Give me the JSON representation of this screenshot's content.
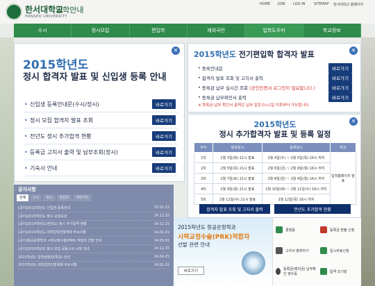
{
  "header": {
    "univ_name": "한서대학교",
    "univ_sub": "입학안내",
    "univ_eng": "HANSEO UNIVERSITY",
    "util_links": [
      "HOME",
      "JOIN",
      "LOG-IN",
      "SITEMAP",
      "한서대학교 홈페이지"
    ]
  },
  "gnb": [
    "수시",
    "정시모집",
    "편입학",
    "재외국민",
    "입학도우미",
    "학교정보"
  ],
  "popup1": {
    "year": "2015학년도",
    "title": "정시 합격자 발표 및 신입생 등록 안내",
    "items": [
      {
        "label": "신입생 등록안내문(수시/정시)",
        "button": "바로가기"
      },
      {
        "label": "정시 모집 합격자 발표 조회",
        "button": "바로가기"
      },
      {
        "label": "전년도 정시 추가합격 현황",
        "button": "바로가기"
      },
      {
        "label": "등록금 고지서 출력 및 납부조회(정시)",
        "button": "바로가기"
      },
      {
        "label": "기숙사 안내",
        "button": "바로가기"
      }
    ]
  },
  "popup2": {
    "year": "2015학년도",
    "title": "전기편입학 합격자 발표",
    "items": [
      {
        "label": "등록안내문",
        "note": "",
        "button": "바로가기"
      },
      {
        "label": "합격자 발표 조회 및 고지서 출력",
        "note": "",
        "button": "바로가기"
      },
      {
        "label": "등록금 납부 실시간 조회",
        "note": "(공인인증서 로그인이 필요합니다.)",
        "button": "바로가기"
      },
      {
        "label": "등록금 납부확인서 출력",
        "note": "",
        "button": "바로가기"
      }
    ],
    "footnote": "※ 등록금 납부 확인서 출력은 납부 일정 D+2일 이후부터 가능합니다."
  },
  "popup3": {
    "year": "2015학년도",
    "title": "정시 추가합격자 발표 및 등록 일정",
    "columns": [
      "차수",
      "발표일시",
      "등록일시",
      "비고"
    ],
    "rows": [
      [
        "1차",
        "2월 3일(화) 21시 발표",
        "2월 4일(수) ~ 2월 5일(목) 16시 까지"
      ],
      [
        "2차",
        "2월 5일(목) 21시 발표",
        "2월 6일(금) ~ 2월 9일(월) 16시 까지"
      ],
      [
        "3차",
        "2월 7일(토) 21시 발표",
        "2월 8일(일) ~ 2월 9일(월) 16시 까지"
      ],
      [
        "4차",
        "2월 9일(월) 21시 발표",
        "2월 10일(화) ~ 2월 11일(수) 16시 까지"
      ],
      [
        "5차",
        "2월 11일(수) 21시 발표",
        "2월 12일(목) 16시 까지"
      ]
    ],
    "remark": "입학홈페이지 발표",
    "btn_left": "합격자 발표 조회 및 고지서 출력",
    "btn_right": "전년도 추가합격 현황"
  },
  "notice": {
    "title": "공지사항",
    "tabs": [
      "전체",
      "수시",
      "정시",
      "편입학",
      "재외국민"
    ],
    "items": [
      {
        "text": "[공지]2015학년도 신입생 등록안내",
        "date": "15.01.22"
      },
      {
        "text": "[공지]2015학년도 정시 모집요강",
        "date": "14.12.15"
      },
      {
        "text": "[공지]2014학년도(전년도) 정시 추가합격 현황",
        "date": "14.12.15"
      },
      {
        "text": "[공지]2015학년도 대학입학전형계획 주요사항",
        "date": "14.01.01"
      },
      {
        "text": "[공지]항공운항학과 시력교정수술(PRK) 적합자 선발 안내",
        "date": "14.05.01"
      },
      {
        "text": "[공지]2015학년도 정시 모집 공동고사 시행 안내",
        "date": "14.12.15"
      },
      {
        "text": "2015학년도 입학설명회(특강) 안내",
        "date": "14.04.25"
      },
      {
        "text": "2015학년도 대학입학전형계획 주요사항",
        "date": "14.01.01"
      }
    ]
  },
  "promo": {
    "line1": "2015학년도 항공운항학과",
    "line2": "시력교정수술(PRK)적합자",
    "line3": "선발 관련 안내",
    "button": "바로가기"
  },
  "quick": [
    {
      "label": "경쟁률",
      "color": "#2f8b4b"
    },
    {
      "label": "등록금 환불 신청",
      "color": "#c0392b"
    },
    {
      "label": "고지서 출력하기",
      "color": "#555555"
    },
    {
      "label": "입시자료신청",
      "color": "#2f8b4b"
    },
    {
      "label": "등록금(예치금) 납부확인 영수증",
      "color": "#444444"
    },
    {
      "label": "합격 조기발",
      "color": "#2f8b4b"
    }
  ]
}
